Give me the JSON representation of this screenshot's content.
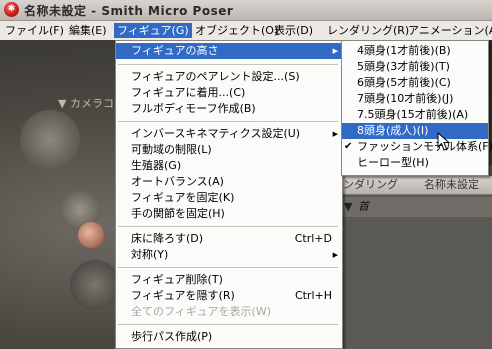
{
  "window": {
    "title": "名称未設定 - Smith Micro Poser"
  },
  "menubar": [
    {
      "label": "ファイル(F)"
    },
    {
      "label": "編集(E)"
    },
    {
      "label": "フィギュア(G)"
    },
    {
      "label": "オブジェクト(O)"
    },
    {
      "label": "表示(D)"
    },
    {
      "label": "レンダリング(R)"
    },
    {
      "label": "アニメーション(A)"
    }
  ],
  "viewport": {
    "camera_label": "▼ カメラコ"
  },
  "right_panel": {
    "tab1": "ンダリング",
    "tab2": "名称未設定",
    "row_label": "首"
  },
  "figure_menu": {
    "items": [
      {
        "label": "フィギュアの高さ",
        "submenu": true,
        "highlighted": true
      },
      {
        "label": "フィギュアのペアレント設定...(S)"
      },
      {
        "label": "フィギュアに着用...(C)"
      },
      {
        "label": "フルボディモーフ作成(B)"
      },
      {
        "label": "インバースキネマティクス設定(U)",
        "submenu": true
      },
      {
        "label": "可動域の制限(L)"
      },
      {
        "label": "生殖器(G)"
      },
      {
        "label": "オートバランス(A)"
      },
      {
        "label": "フィギュアを固定(K)"
      },
      {
        "label": "手の関節を固定(H)"
      },
      {
        "label": "床に降ろす(D)",
        "shortcut": "Ctrl+D"
      },
      {
        "label": "対称(Y)",
        "submenu": true
      },
      {
        "label": "フィギュア削除(T)"
      },
      {
        "label": "フィギュアを隠す(R)",
        "shortcut": "Ctrl+H"
      },
      {
        "label": "全てのフィギュアを表示(W)",
        "disabled": true
      },
      {
        "label": "歩行パス作成(P)"
      }
    ]
  },
  "height_submenu": {
    "items": [
      {
        "label": "4頭身(1才前後)(B)"
      },
      {
        "label": "5頭身(3才前後)(T)"
      },
      {
        "label": "6頭身(5才前後)(C)"
      },
      {
        "label": "7頭身(10才前後)(J)"
      },
      {
        "label": "7.5頭身(15才前後)(A)"
      },
      {
        "label": "8頭身(成人)(I)",
        "highlighted": true
      },
      {
        "label": "ファッションモデル体系(F)",
        "checked": true
      },
      {
        "label": "ヒーロー型(H)"
      }
    ]
  },
  "icons": {
    "arrow": "▶",
    "check": "✔"
  }
}
